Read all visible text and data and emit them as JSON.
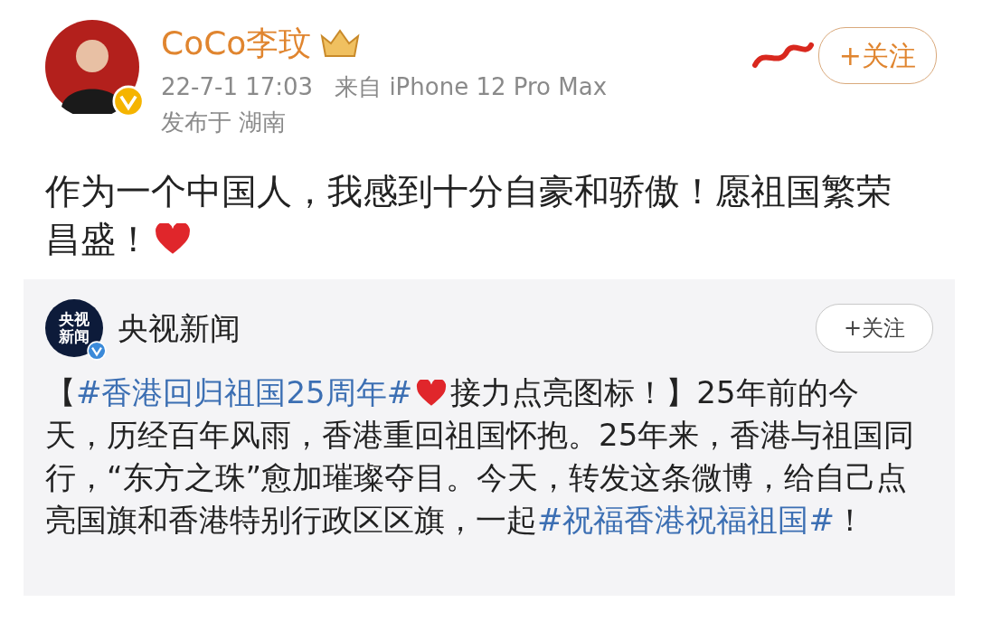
{
  "post": {
    "author": "CoCo李玟",
    "verified": true,
    "time": "22-7-1 17:03",
    "source": "来自 iPhone 12 Pro Max",
    "location": "发布于 湖南",
    "follow_button": "+关注",
    "segments": [
      {
        "kind": "text",
        "text": "作为一个中国人，我感到十分自豪和骄傲！愿祖国繁荣昌盛！"
      },
      {
        "kind": "heart"
      }
    ]
  },
  "repost": {
    "author": "央视新闻",
    "logo_lines": [
      "央视",
      "新闻"
    ],
    "verified": true,
    "follow_button": "+关注",
    "segments": [
      {
        "kind": "text",
        "text": "【"
      },
      {
        "kind": "hashtag",
        "text": "#香港回归祖国25周年#"
      },
      {
        "kind": "heart"
      },
      {
        "kind": "text",
        "text": "接力点亮图标！】25年前的今天，历经百年风雨，香港重回祖国怀抱。25年来，香港与祖国同行，“东方之珠”愈加璀璨夺目。今天，转发这条微博，给自己点亮国旗和香港特别行政区区旗，一起"
      },
      {
        "kind": "hashtag",
        "text": "#祝福香港祝福祖国#"
      },
      {
        "kind": "text",
        "text": "！"
      }
    ]
  }
}
